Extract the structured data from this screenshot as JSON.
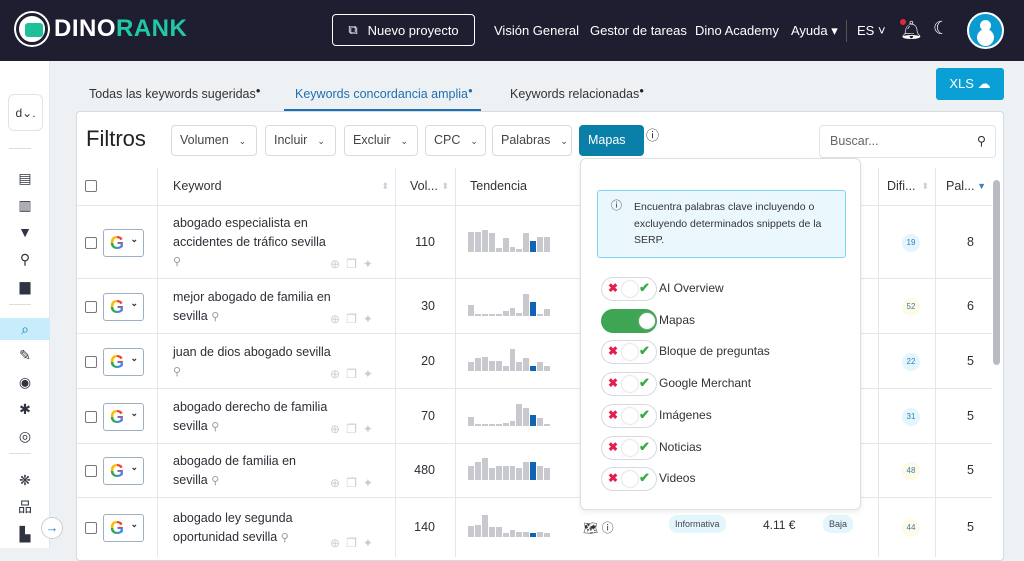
{
  "brand": {
    "name_a": "DINO",
    "name_b": "RANK"
  },
  "nav": {
    "new_project": "Nuevo proyecto",
    "links": [
      "Visión General",
      "Gestor de tareas",
      "Dino Academy",
      "Ayuda ▾"
    ],
    "language": "ES ˅"
  },
  "sidebar": {
    "project": "d⌄."
  },
  "tabs": [
    {
      "label": "Todas las keywords sugeridas"
    },
    {
      "label": "Keywords concordancia amplia"
    },
    {
      "label": "Keywords relacionadas"
    }
  ],
  "export": {
    "label": "XLS"
  },
  "filters": {
    "title": "Filtros",
    "buttons": [
      "Volumen",
      "Incluir",
      "Excluir",
      "CPC",
      "Palabras"
    ],
    "active": "Mapas",
    "search_placeholder": "Buscar..."
  },
  "columns": {
    "keyword": "Keyword",
    "volume": "Vol...",
    "trend": "Tendencia",
    "difficulty": "Difi...",
    "words": "Pal..."
  },
  "rows": [
    {
      "keyword": "abogado especialista en accidentes de tráfico sevilla",
      "volume": "110",
      "trend": [
        0.9,
        0.9,
        1,
        0.85,
        0.15,
        0.6,
        0.2,
        0.1,
        0.85,
        0.5,
        0.65,
        0.65
      ],
      "difficulty": "19",
      "diff_color": "#e4f6fd",
      "words": "8"
    },
    {
      "keyword": "mejor abogado de familia en sevilla",
      "volume": "30",
      "trend": [
        0.5,
        0.05,
        0.05,
        0.05,
        0.05,
        0.2,
        0.35,
        0.1,
        1,
        0.6,
        0.05,
        0.3
      ],
      "difficulty": "52",
      "diff_color": "#fdfbe6",
      "words": "6"
    },
    {
      "keyword": "juan de dios abogado sevilla",
      "volume": "20",
      "trend": [
        0.4,
        0.55,
        0.6,
        0.45,
        0.45,
        0.2,
        1,
        0.4,
        0.55,
        0.2,
        0.4,
        0.2
      ],
      "difficulty": "22",
      "diff_color": "#e4f6fd",
      "words": "5"
    },
    {
      "keyword": "abogado derecho de familia sevilla",
      "volume": "70",
      "trend": [
        0.4,
        0.05,
        0.05,
        0.05,
        0.05,
        0.1,
        0.2,
        1,
        0.8,
        0.5,
        0.35,
        0.05
      ],
      "difficulty": "31",
      "diff_color": "#e4f6fd",
      "words": "5"
    },
    {
      "keyword": "abogado de familia en sevilla",
      "volume": "480",
      "trend": [
        0.65,
        0.8,
        1,
        0.55,
        0.65,
        0.65,
        0.65,
        0.55,
        0.8,
        0.8,
        0.65,
        0.55
      ],
      "difficulty": "48",
      "diff_color": "#fdfbe6",
      "words": "5"
    },
    {
      "keyword": "abogado ley segunda oportunidad sevilla",
      "volume": "140",
      "trend": [
        0.5,
        0.55,
        1,
        0.45,
        0.45,
        0.2,
        0.3,
        0.25,
        0.25,
        0.2,
        0.25,
        0.2
      ],
      "difficulty": "44",
      "diff_color": "#fdfbe6",
      "words": "5",
      "intent": "Informativa",
      "cpc": "4.11 €",
      "competition": "Baja"
    }
  ],
  "popup": {
    "info": "Encuentra palabras clave incluyendo o excluyendo determinados snippets de la SERP.",
    "toggles": [
      {
        "label": "AI Overview",
        "on": false
      },
      {
        "label": "Mapas",
        "on": true
      },
      {
        "label": "Bloque de preguntas",
        "on": false
      },
      {
        "label": "Google Merchant",
        "on": false
      },
      {
        "label": "Imágenes",
        "on": false
      },
      {
        "label": "Noticias",
        "on": false
      },
      {
        "label": "Videos",
        "on": false
      }
    ]
  }
}
